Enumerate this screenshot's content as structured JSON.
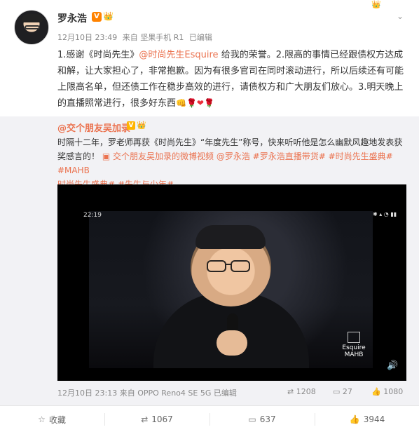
{
  "post": {
    "author": "罗永浩",
    "verified_label": "V",
    "crown_label": "👑",
    "meta": {
      "date": "12月10日 23:49",
      "source": "来自 坚果手机 R1",
      "edited": "已编辑"
    },
    "text_segments": [
      "1.感谢《时尚先生》",
      "@时尚先生Esquire",
      " 给我的荣誉。2.限高的事情已经跟债权方达成和解，让大家担心了，非常抱歉。因为有很多官司在同时滚动进行，所以后续还有可能上限高名单，但还债工作在稳步高效的进行，请债权方和广大朋友们放心。3.明天晚上的直播照常进行，很多好东西"
    ],
    "emoji_tail": [
      "🌹",
      "❤",
      "🌹"
    ],
    "emoji_fist": "👊"
  },
  "repost": {
    "author": "@交个朋友吴加录",
    "verified_label": "V",
    "crown_label": "👑",
    "text": "时隔十二年，罗老师再获《时尚先生》“年度先生”称号，快来听听他是怎么幽默风趣地发表获奖感言的！",
    "video_link": "交个朋友吴加录的微博视频",
    "topics_line1": "@罗永浩 #罗永浩直播带货# #时尚先生盛典# #MAHB",
    "topics_line2": "时尚先生盛典# #先生与少年#",
    "video": {
      "time": "22:19",
      "logo_text": "MAHB",
      "logo_sub": "Esquire"
    },
    "meta": {
      "date": "12月10日 23:13",
      "source": "来自 OPPO Reno4 SE 5G",
      "edited": "已编辑"
    },
    "stats": {
      "reposts": "1208",
      "comments": "27",
      "likes": "1080"
    }
  },
  "actions": {
    "favorite": "收藏",
    "repost": "1067",
    "comment": "637",
    "like": "3944"
  },
  "icons": {
    "more": "chevron-down-icon",
    "sound": "speaker-icon",
    "repost": "repost-icon",
    "comment": "comment-icon",
    "like": "thumbs-up-icon",
    "favorite": "star-icon"
  },
  "colors": {
    "accent": "#eb7350",
    "vip": "#ff8200",
    "repost_bg": "#f2f2f5"
  }
}
